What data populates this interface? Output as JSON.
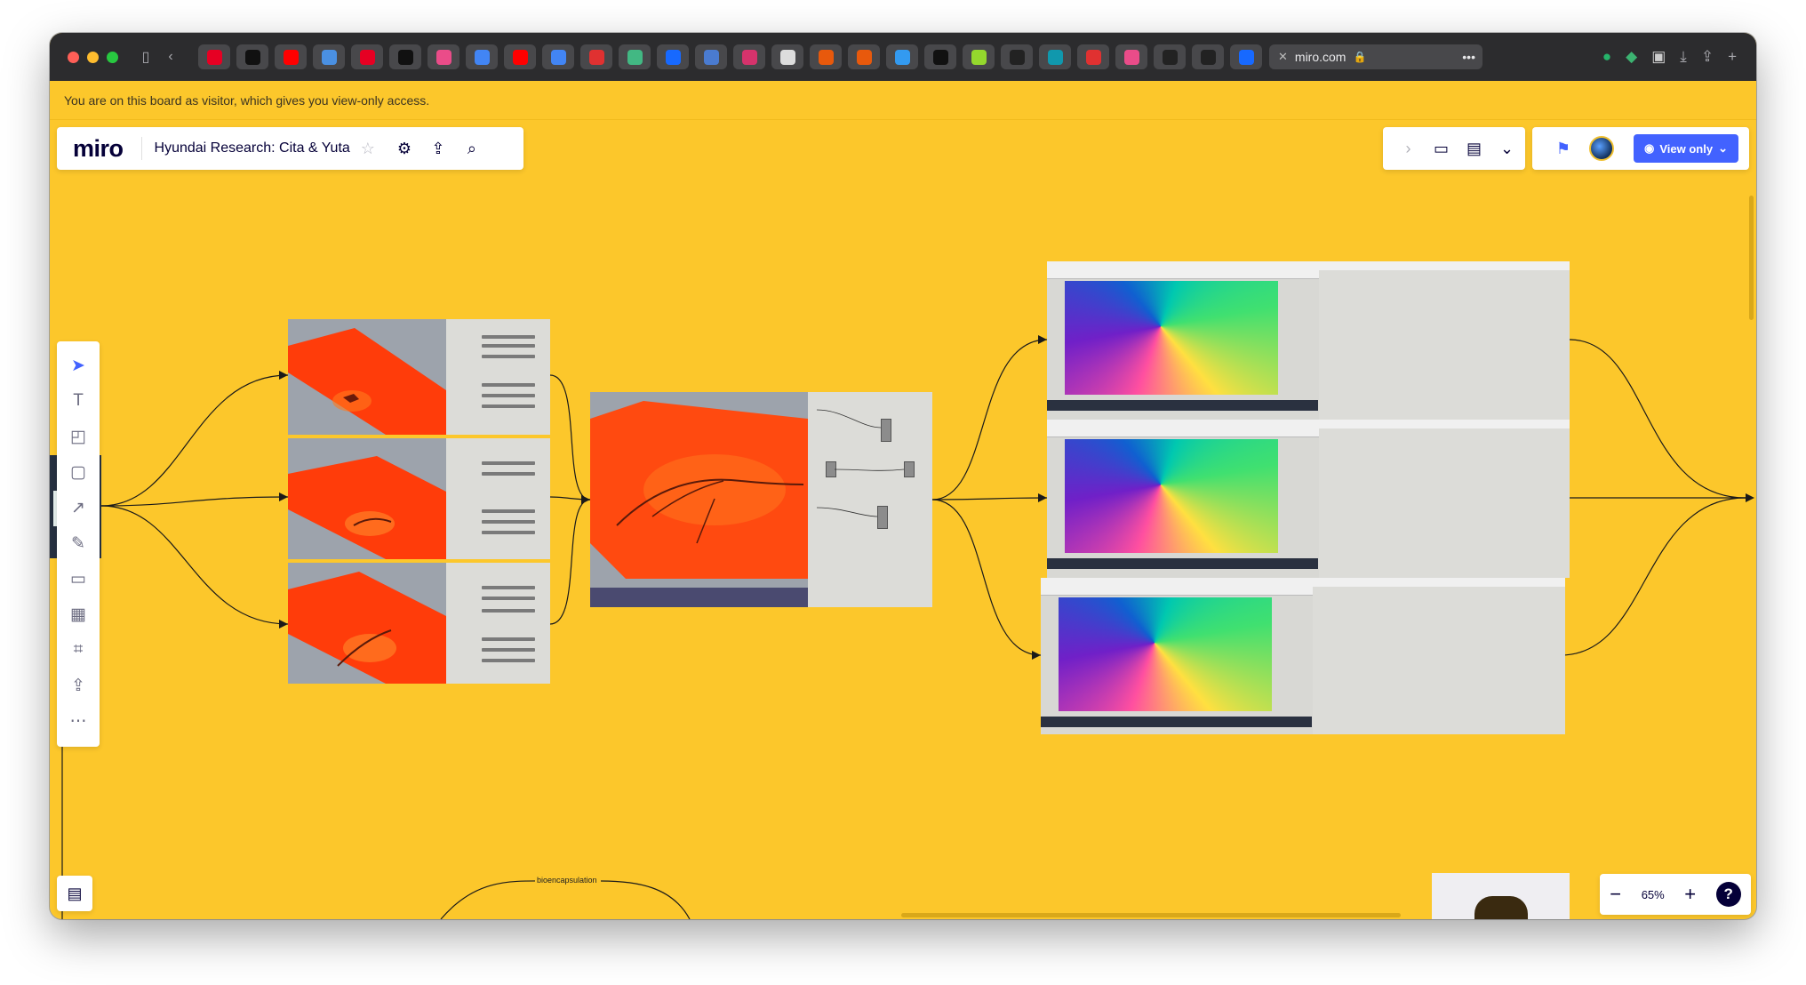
{
  "browser": {
    "url": "miro.com",
    "pinned_tabs": [
      {
        "icon": "pinterest-icon",
        "color": "#e60023"
      },
      {
        "icon": "jy-icon",
        "color": "#111111"
      },
      {
        "icon": "youtube-icon",
        "color": "#ff0000"
      },
      {
        "icon": "maps-icon",
        "color": "#4a90e2"
      },
      {
        "icon": "pinterest-icon",
        "color": "#e60023"
      },
      {
        "icon": "miro-tab-icon",
        "color": "#111111"
      },
      {
        "icon": "dribbble-icon",
        "color": "#ea4c89"
      },
      {
        "icon": "google-icon",
        "color": "#4285f4"
      },
      {
        "icon": "youtube-icon",
        "color": "#ff0000"
      },
      {
        "icon": "google-icon",
        "color": "#4285f4"
      },
      {
        "icon": "dice-icon",
        "color": "#e03131"
      },
      {
        "icon": "vue-icon",
        "color": "#42b883"
      },
      {
        "icon": "behance-icon",
        "color": "#1769ff"
      },
      {
        "icon": "docs-icon",
        "color": "#4a7bd0"
      },
      {
        "icon": "app-icon",
        "color": "#d6336c"
      },
      {
        "icon": "notes-icon",
        "color": "#dddddd"
      },
      {
        "icon": "tool-icon",
        "color": "#e8590c"
      },
      {
        "icon": "tool-icon",
        "color": "#e8590c"
      },
      {
        "icon": "circle-icon",
        "color": "#339af0"
      },
      {
        "icon": "miro-tab-icon",
        "color": "#111111"
      },
      {
        "icon": "p-icon",
        "color": "#94d82d"
      },
      {
        "icon": "bolt-icon",
        "color": "#222222"
      },
      {
        "icon": "app-icon",
        "color": "#1098ad"
      },
      {
        "icon": "record-icon",
        "color": "#e03131"
      },
      {
        "icon": "dribbble-icon",
        "color": "#ea4c89"
      },
      {
        "icon": "figma-icon",
        "color": "#222222"
      },
      {
        "icon": "figma-icon",
        "color": "#222222"
      },
      {
        "icon": "behance-icon",
        "color": "#1769ff"
      }
    ]
  },
  "banner": {
    "text": "You are on this board as visitor, which gives you view-only access."
  },
  "header": {
    "logo": "miro",
    "board_title": "Hyundai Research: Cita & Yuta",
    "view_only_label": "View only"
  },
  "zoom": {
    "level": "65%",
    "minus": "−",
    "plus": "+",
    "help": "?"
  },
  "canvas": {
    "connector_label": "bioencapsulation",
    "accent": "#fcc72b"
  }
}
